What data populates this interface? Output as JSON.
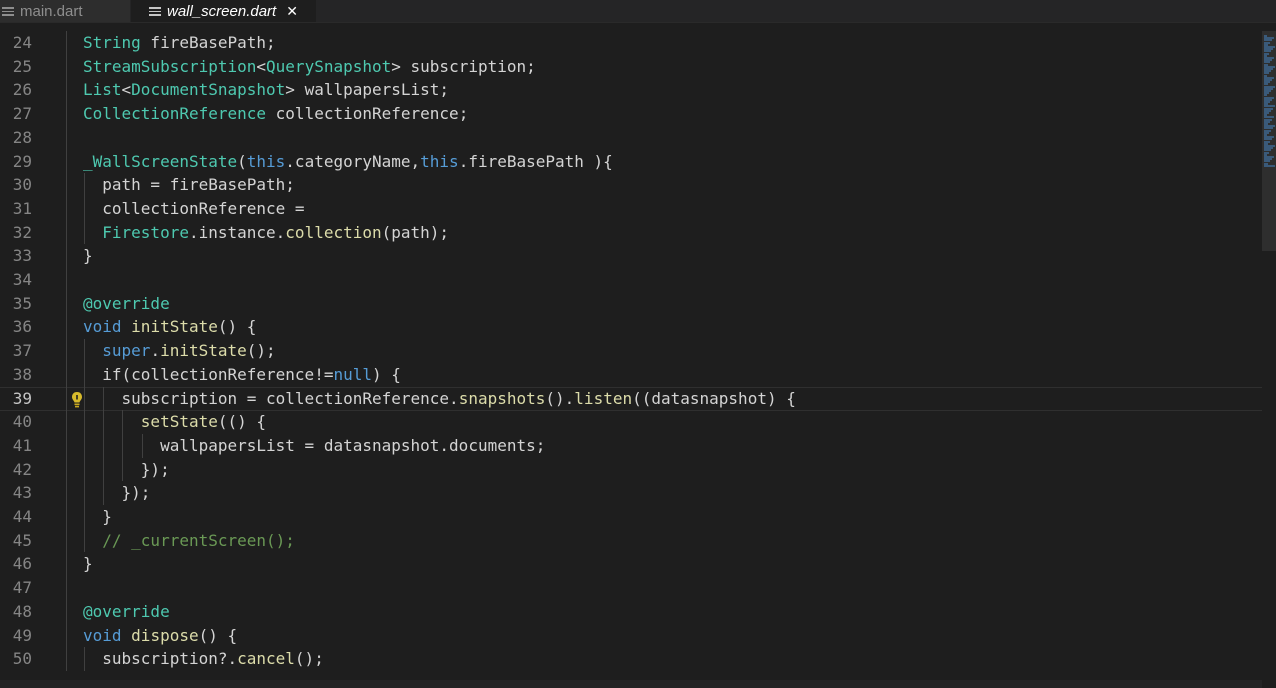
{
  "tabs": [
    {
      "label": "main.dart",
      "active": false,
      "icon": "file-lines-icon"
    },
    {
      "label": "wall_screen.dart",
      "active": true,
      "icon": "file-lines-icon",
      "close": "✕"
    }
  ],
  "colors": {
    "background": "#1e1e1e",
    "keyword": "#569cd6",
    "type": "#4ec9b0",
    "function": "#dcdcaa",
    "comment": "#6a9955",
    "text": "#d4d4d4",
    "line_number": "#858585"
  },
  "editor": {
    "current_line": "39",
    "lines": [
      {
        "n": "24",
        "tokens": [
          [
            "String",
            "ty"
          ],
          [
            " fireBasePath;",
            ""
          ]
        ]
      },
      {
        "n": "25",
        "tokens": [
          [
            "StreamSubscription",
            "ty"
          ],
          [
            "<",
            ""
          ],
          [
            "QuerySnapshot",
            "ty"
          ],
          [
            "> subscription;",
            ""
          ]
        ]
      },
      {
        "n": "26",
        "tokens": [
          [
            "List",
            "ty"
          ],
          [
            "<",
            ""
          ],
          [
            "DocumentSnapshot",
            "ty"
          ],
          [
            "> wallpapersList;",
            ""
          ]
        ]
      },
      {
        "n": "27",
        "tokens": [
          [
            "CollectionReference",
            "ty"
          ],
          [
            " collectionReference;",
            ""
          ]
        ]
      },
      {
        "n": "28",
        "tokens": []
      },
      {
        "n": "29",
        "tokens": [
          [
            "_WallScreenState",
            "ty"
          ],
          [
            "(",
            ""
          ],
          [
            "this",
            "kw"
          ],
          [
            ".categoryName,",
            ""
          ],
          [
            "this",
            "kw"
          ],
          [
            ".fireBasePath ){",
            ""
          ]
        ]
      },
      {
        "n": "30",
        "tokens": [
          [
            "  path = fireBasePath;",
            ""
          ]
        ]
      },
      {
        "n": "31",
        "tokens": [
          [
            "  collectionReference =",
            ""
          ]
        ]
      },
      {
        "n": "32",
        "tokens": [
          [
            "  ",
            ""
          ],
          [
            "Firestore",
            "ty"
          ],
          [
            ".instance.",
            ""
          ],
          [
            "collection",
            "fn"
          ],
          [
            "(path);",
            ""
          ]
        ]
      },
      {
        "n": "33",
        "tokens": [
          [
            "}",
            ""
          ]
        ]
      },
      {
        "n": "34",
        "tokens": []
      },
      {
        "n": "35",
        "tokens": [
          [
            "@override",
            "ty"
          ]
        ]
      },
      {
        "n": "36",
        "tokens": [
          [
            "void",
            "kw"
          ],
          [
            " ",
            ""
          ],
          [
            "initState",
            "fn"
          ],
          [
            "() {",
            ""
          ]
        ]
      },
      {
        "n": "37",
        "tokens": [
          [
            "  ",
            ""
          ],
          [
            "super",
            "kw"
          ],
          [
            ".",
            ""
          ],
          [
            "initState",
            "fn"
          ],
          [
            "();",
            ""
          ]
        ]
      },
      {
        "n": "38",
        "tokens": [
          [
            "  if(collectionReference!=",
            ""
          ],
          [
            "null",
            "kw"
          ],
          [
            ") {",
            ""
          ]
        ]
      },
      {
        "n": "39",
        "tokens": [
          [
            "    subscription = collectionReference.",
            ""
          ],
          [
            "snapshots",
            "fn"
          ],
          [
            "().",
            ""
          ],
          [
            "listen",
            "fn"
          ],
          [
            "((datasnapshot) {",
            ""
          ]
        ]
      },
      {
        "n": "40",
        "tokens": [
          [
            "      ",
            ""
          ],
          [
            "setState",
            "fn"
          ],
          [
            "(() {",
            ""
          ]
        ]
      },
      {
        "n": "41",
        "tokens": [
          [
            "        wallpapersList = datasnapshot.documents;",
            ""
          ]
        ]
      },
      {
        "n": "42",
        "tokens": [
          [
            "      });",
            ""
          ]
        ]
      },
      {
        "n": "43",
        "tokens": [
          [
            "    });",
            ""
          ]
        ]
      },
      {
        "n": "44",
        "tokens": [
          [
            "  }",
            ""
          ]
        ]
      },
      {
        "n": "45",
        "tokens": [
          [
            "  // _currentScreen();",
            "cm"
          ]
        ]
      },
      {
        "n": "46",
        "tokens": [
          [
            "}",
            ""
          ]
        ]
      },
      {
        "n": "47",
        "tokens": []
      },
      {
        "n": "48",
        "tokens": [
          [
            "@override",
            "ty"
          ]
        ]
      },
      {
        "n": "49",
        "tokens": [
          [
            "void",
            "kw"
          ],
          [
            " ",
            ""
          ],
          [
            "dispose",
            "fn"
          ],
          [
            "() {",
            ""
          ]
        ]
      },
      {
        "n": "50",
        "tokens": [
          [
            "  subscription?.",
            ""
          ],
          [
            "cancel",
            "fn"
          ],
          [
            "();",
            ""
          ]
        ]
      }
    ]
  }
}
